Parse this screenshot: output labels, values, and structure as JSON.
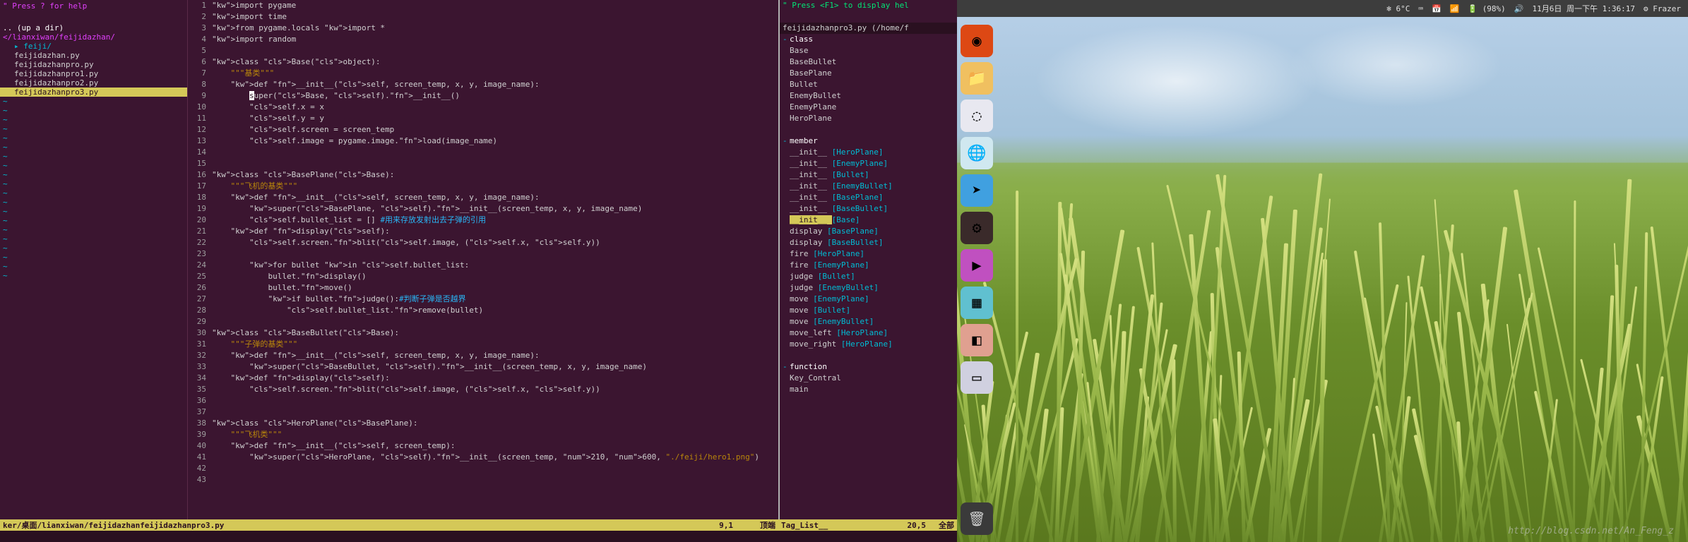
{
  "filetree": {
    "help": "\" Press ? for help",
    "updir": ".. (up a dir)",
    "path": "</lianxiwan/feijidazhan/",
    "dir": "feiji/",
    "files": [
      "feijidazhan.py",
      "feijidazhanpro.py",
      "feijidazhanpro1.py",
      "feijidazhanpro2.py",
      "feijidazhanpro3.py"
    ]
  },
  "code": {
    "lines": [
      {
        "n": 1,
        "t": "import pygame"
      },
      {
        "n": 2,
        "t": "import time"
      },
      {
        "n": 3,
        "t": "from pygame.locals import *"
      },
      {
        "n": 4,
        "t": "import random"
      },
      {
        "n": 5,
        "t": ""
      },
      {
        "n": 6,
        "t": "class Base(object):"
      },
      {
        "n": 7,
        "t": "    \"\"\"基类\"\"\""
      },
      {
        "n": 8,
        "t": "    def __init__(self, screen_temp, x, y, image_name):"
      },
      {
        "n": 9,
        "t": "        super(Base, self).__init__()"
      },
      {
        "n": 10,
        "t": "        self.x = x"
      },
      {
        "n": 11,
        "t": "        self.y = y"
      },
      {
        "n": 12,
        "t": "        self.screen = screen_temp"
      },
      {
        "n": 13,
        "t": "        self.image = pygame.image.load(image_name)"
      },
      {
        "n": 14,
        "t": ""
      },
      {
        "n": 15,
        "t": ""
      },
      {
        "n": 16,
        "t": "class BasePlane(Base):"
      },
      {
        "n": 17,
        "t": "    \"\"\"飞机的基类\"\"\""
      },
      {
        "n": 18,
        "t": "    def __init__(self, screen_temp, x, y, image_name):"
      },
      {
        "n": 19,
        "t": "        super(BasePlane, self).__init__(screen_temp, x, y, image_name)"
      },
      {
        "n": 20,
        "t": "        self.bullet_list = [] #用来存放发射出去子弹的引用"
      },
      {
        "n": 21,
        "t": "    def display(self):"
      },
      {
        "n": 22,
        "t": "        self.screen.blit(self.image, (self.x, self.y))"
      },
      {
        "n": 23,
        "t": ""
      },
      {
        "n": 24,
        "t": "        for bullet in self.bullet_list:"
      },
      {
        "n": 25,
        "t": "            bullet.display()"
      },
      {
        "n": 26,
        "t": "            bullet.move()"
      },
      {
        "n": 27,
        "t": "            if bullet.judge():#判断子弹是否越界"
      },
      {
        "n": 28,
        "t": "                self.bullet_list.remove(bullet)"
      },
      {
        "n": 29,
        "t": ""
      },
      {
        "n": 30,
        "t": "class BaseBullet(Base):"
      },
      {
        "n": 31,
        "t": "    \"\"\"子弹的基类\"\"\""
      },
      {
        "n": 32,
        "t": "    def __init__(self, screen_temp, x, y, image_name):"
      },
      {
        "n": 33,
        "t": "        super(BaseBullet, self).__init__(screen_temp, x, y, image_name)"
      },
      {
        "n": 34,
        "t": "    def display(self):"
      },
      {
        "n": 35,
        "t": "        self.screen.blit(self.image, (self.x, self.y))"
      },
      {
        "n": 36,
        "t": ""
      },
      {
        "n": 37,
        "t": ""
      },
      {
        "n": 38,
        "t": "class HeroPlane(BasePlane):"
      },
      {
        "n": 39,
        "t": "    \"\"\"飞机类\"\"\""
      },
      {
        "n": 40,
        "t": "    def __init__(self, screen_temp):"
      },
      {
        "n": 41,
        "t": "        super(HeroPlane, self).__init__(screen_temp, 210, 600, \"./feiji/hero1.png\")"
      },
      {
        "n": 42,
        "t": ""
      },
      {
        "n": 43,
        "t": ""
      }
    ]
  },
  "status": {
    "path": "ker/桌面/lianxiwan/feijidazhan",
    "file": "feijidazhanpro3.py",
    "pos": "9,1",
    "scroll": "顶端",
    "tag": "Tag_List__",
    "tagpos": "20,5",
    "tagscroll": "全部"
  },
  "taglist": {
    "help": "\" Press <F1> to display hel",
    "title": "feijidazhanpro3.py (/home/f",
    "class_hdr": "class",
    "classes": [
      "Base",
      "BaseBullet",
      "BasePlane",
      "Bullet",
      "EnemyBullet",
      "EnemyPlane",
      "HeroPlane"
    ],
    "member_hdr": "member",
    "members": [
      {
        "n": "__init__",
        "c": "[HeroPlane]"
      },
      {
        "n": "__init__",
        "c": "[EnemyPlane]"
      },
      {
        "n": "__init__",
        "c": "[Bullet]"
      },
      {
        "n": "__init__",
        "c": "[EnemyBullet]"
      },
      {
        "n": "__init__",
        "c": "[BasePlane]"
      },
      {
        "n": "__init__",
        "c": "[BaseBullet]"
      },
      {
        "n": "__init__",
        "c": "[Base]",
        "hl": true
      },
      {
        "n": "display",
        "c": "[BasePlane]"
      },
      {
        "n": "display",
        "c": "[BaseBullet]"
      },
      {
        "n": "fire",
        "c": "[HeroPlane]"
      },
      {
        "n": "fire",
        "c": "[EnemyPlane]"
      },
      {
        "n": "judge",
        "c": "[Bullet]"
      },
      {
        "n": "judge",
        "c": "[EnemyBullet]"
      },
      {
        "n": "move",
        "c": "[EnemyPlane]"
      },
      {
        "n": "move",
        "c": "[Bullet]"
      },
      {
        "n": "move",
        "c": "[EnemyBullet]"
      },
      {
        "n": "move_left",
        "c": "[HeroPlane]"
      },
      {
        "n": "move_right",
        "c": "[HeroPlane]"
      }
    ],
    "func_hdr": "function",
    "functions": [
      "Key_Contral",
      "main"
    ]
  },
  "topbar": {
    "weather": "6°C",
    "battery": "(98%)",
    "date": "11月6日 周一下午 1:36:17",
    "user": "Frazer"
  },
  "launcher": [
    {
      "name": "dash-icon",
      "bg": "#dd4814",
      "glyph": "◉"
    },
    {
      "name": "files-icon",
      "bg": "#f0c060",
      "glyph": "📁"
    },
    {
      "name": "loading-icon",
      "bg": "#e8e8f0",
      "glyph": "◌"
    },
    {
      "name": "earth-icon",
      "bg": "#d0e8f0",
      "glyph": "🌐"
    },
    {
      "name": "forward-icon",
      "bg": "#40a0e0",
      "glyph": "➤"
    },
    {
      "name": "shell-icon",
      "bg": "#3a2a2a",
      "glyph": "⚙"
    },
    {
      "name": "media-icon",
      "bg": "#c050c0",
      "glyph": "▶"
    },
    {
      "name": "tiles-icon",
      "bg": "#60c0d0",
      "glyph": "▦"
    },
    {
      "name": "patch-icon",
      "bg": "#e0a090",
      "glyph": "◧"
    },
    {
      "name": "display-icon",
      "bg": "#d0d0e0",
      "glyph": "▭"
    }
  ],
  "watermark": "http://blog.csdn.net/An_Feng_z"
}
